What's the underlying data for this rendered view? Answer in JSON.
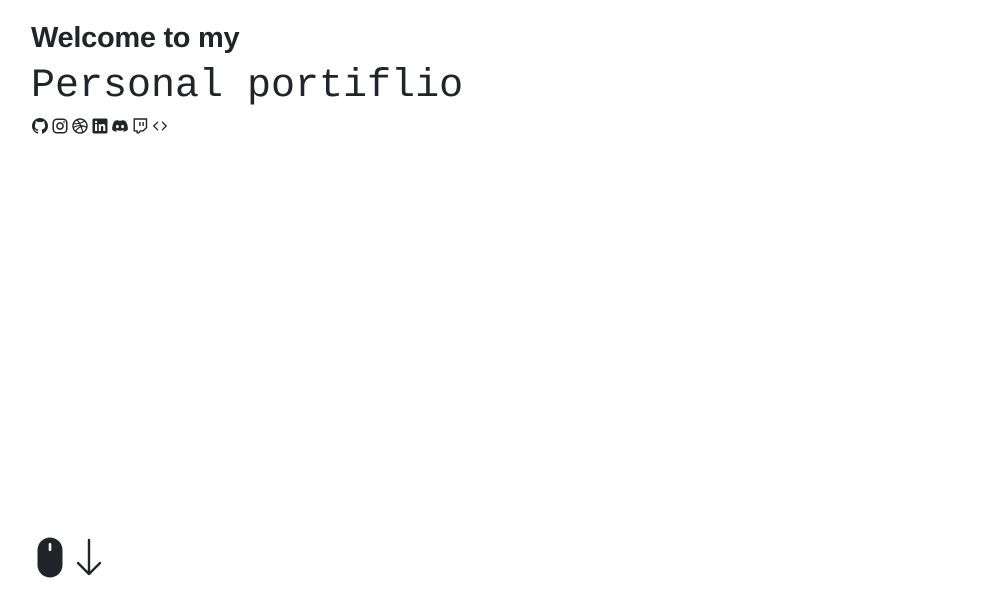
{
  "hero": {
    "welcome": "Welcome to my",
    "title": "Personal portiflio"
  },
  "socials": [
    {
      "name": "github",
      "icon": "github-icon"
    },
    {
      "name": "instagram",
      "icon": "instagram-icon"
    },
    {
      "name": "dribbble",
      "icon": "dribbble-icon"
    },
    {
      "name": "linkedin",
      "icon": "linkedin-icon"
    },
    {
      "name": "discord",
      "icon": "discord-icon"
    },
    {
      "name": "twitch",
      "icon": "twitch-icon"
    },
    {
      "name": "code",
      "icon": "code-icon"
    }
  ],
  "scroll_hint": {
    "mouse_icon": "mouse-icon",
    "arrow_icon": "arrow-down-icon"
  },
  "colors": {
    "text": "#212529",
    "background": "#ffffff"
  }
}
